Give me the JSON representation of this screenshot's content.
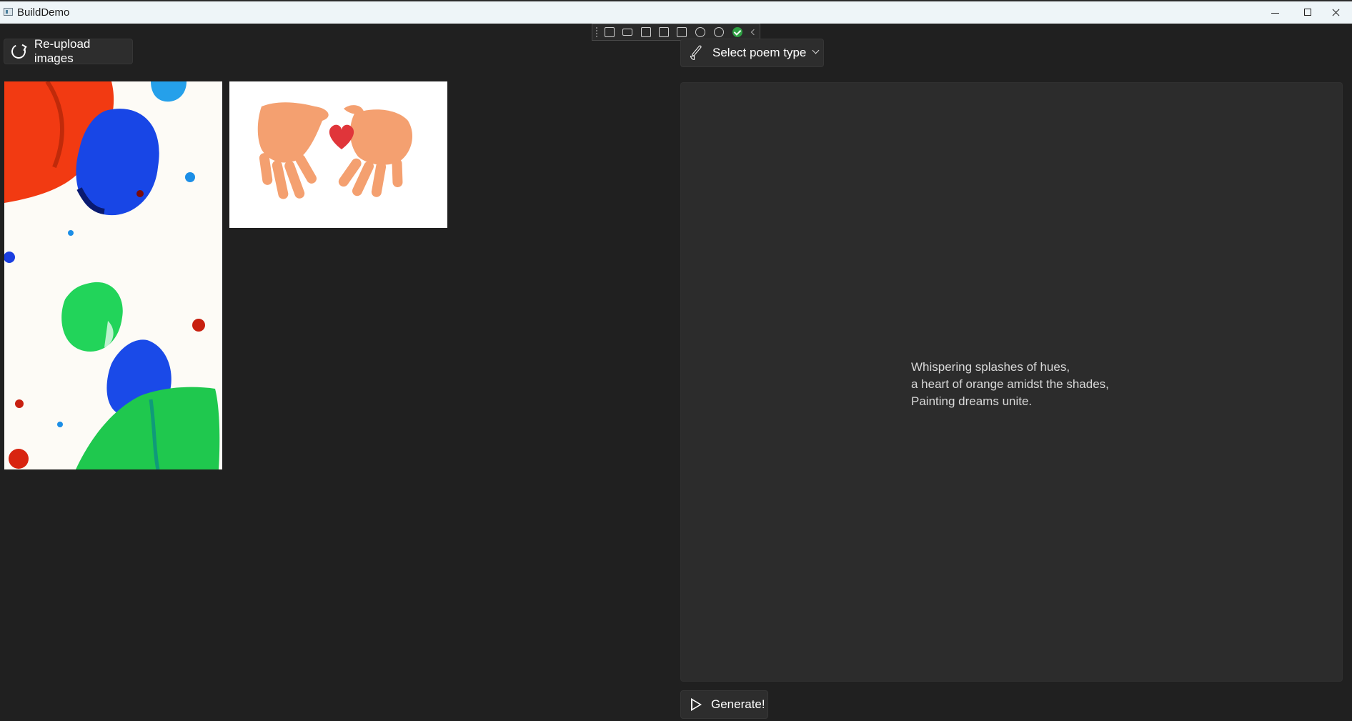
{
  "window": {
    "title": "BuildDemo"
  },
  "toolbar": {
    "reupload_label": "Re-upload images"
  },
  "poem_selector": {
    "label": "Select poem type"
  },
  "poem": {
    "lines": [
      "Whispering splashes of hues,",
      "a heart of orange amidst the shades,",
      "Painting dreams unite."
    ]
  },
  "actions": {
    "generate_label": "Generate!"
  },
  "colors": {
    "background": "#202020",
    "panel": "#2c2c2c",
    "button": "#2d2d2d",
    "titlebar": "#eef5f8"
  },
  "icons": {
    "reupload": "refresh-icon",
    "poem_type": "brush-icon",
    "dropdown": "chevron-down-icon",
    "generate": "play-icon"
  }
}
